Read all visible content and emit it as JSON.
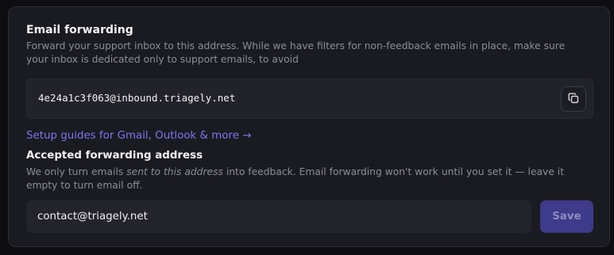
{
  "email_forwarding": {
    "title": "Email forwarding",
    "description": "Forward your support inbox to this address. While we have filters for non-feedback emails in place, make sure your inbox is dedicated only to support emails, to avoid",
    "inbound_address": "4e24a1c3f063@inbound.triagely.net",
    "copy_icon": "copy-icon",
    "setup_link": "Setup guides for Gmail, Outlook & more →"
  },
  "accepted": {
    "title": "Accepted forwarding address",
    "desc_before": "We only turn emails ",
    "desc_emphasis": "sent to this address",
    "desc_after": " into feedback. Email forwarding won't work until you set it — leave it empty to turn email off.",
    "input_value": "contact@triagely.net",
    "save_label": "Save"
  },
  "colors": {
    "accent": "#7f74f0",
    "save_button": "#3d3b8a"
  }
}
